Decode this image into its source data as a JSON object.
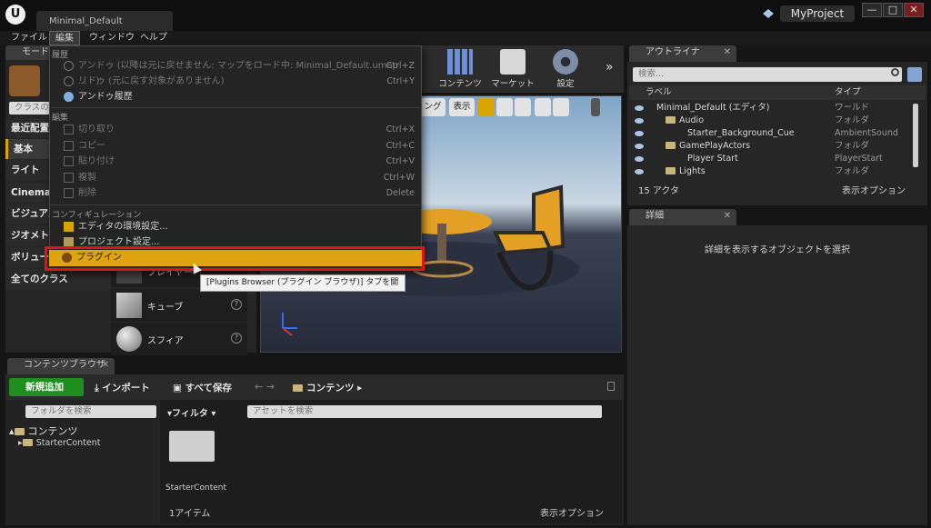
{
  "window": {
    "logo": "U",
    "doc_tab": "Minimal_Default",
    "project": "MyProject",
    "controls": [
      "—",
      "□",
      "✕"
    ]
  },
  "menubar": [
    "ファイル",
    "編集",
    "ウィンドウ",
    "ヘルプ"
  ],
  "modes": {
    "tab": "モード",
    "search_placeholder": "クラスの",
    "categories": [
      "最近配置",
      "基本",
      "ライト",
      "Cinemati",
      "ビジュアル",
      "ジオメト",
      "ボリュー",
      "全てのクラス"
    ],
    "assets": [
      "キューブ",
      "スフィア"
    ]
  },
  "edit_menu": {
    "history_section": "履歴",
    "undo": {
      "label": "アンドゥ (以降は元に戻せません: マップをロード中: Minimal_Default.umap ...　)",
      "shortcut": "Ctrl+Z"
    },
    "redo": {
      "label": "リドゥ (元に戻す対象がありません)",
      "shortcut": "Ctrl+Y"
    },
    "undo_history": "アンドゥ履歴",
    "edit_section": "編集",
    "cut": {
      "label": "切り取り",
      "shortcut": "Ctrl+X"
    },
    "copy": {
      "label": "コピー",
      "shortcut": "Ctrl+C"
    },
    "paste": {
      "label": "貼り付け",
      "shortcut": "Ctrl+V"
    },
    "duplicate": {
      "label": "複製",
      "shortcut": "Ctrl+W"
    },
    "delete": {
      "label": "削除",
      "shortcut": "Delete"
    },
    "config_section": "コンフィギュレーション",
    "editor_prefs": "エディタの環境設定...",
    "project_settings": "プロジェクト設定...",
    "plugins": "プラグイン",
    "tooltip": "[Plugins Browser (プラグイン ブラウザ)] タブを開きます。",
    "partial_asset": "プレイヤー"
  },
  "toolbar": {
    "content": "コンテンツ",
    "market": "マーケット",
    "settings": "設定"
  },
  "viewport": {
    "btn_lighting": "ング",
    "btn_show": "表示"
  },
  "outliner": {
    "tab": "アウトライナ",
    "search_placeholder": "検索...",
    "col_label": "ラベル",
    "col_type": "タイプ",
    "rows": [
      {
        "name": "Minimal_Default (エディタ)",
        "type": "ワールド"
      },
      {
        "name": "Audio",
        "type": "フォルダ"
      },
      {
        "name": "Starter_Background_Cue",
        "type": "AmbientSound"
      },
      {
        "name": "GamePlayActors",
        "type": "フォルダ"
      },
      {
        "name": "Player Start",
        "type": "PlayerStart"
      },
      {
        "name": "Lights",
        "type": "フォルダ"
      }
    ],
    "actor_count": "15 アクタ",
    "view_options": "表示オプション"
  },
  "details": {
    "tab": "詳細",
    "empty_message": "詳細を表示するオブジェクトを選択"
  },
  "content_browser": {
    "tab": "コンテンツブラウザ",
    "add_new": "新規追加",
    "import": "インポート",
    "save_all": "すべて保存",
    "path": "コンテンツ",
    "folder_search_placeholder": "フォルダを検索",
    "tree_root": "コンテンツ",
    "tree_child": "StarterContent",
    "filter": "フィルタ",
    "asset_search_placeholder": "アセットを検索",
    "folder_name": "StarterContent",
    "item_count": "1アイテム",
    "view_options": "表示オプション"
  },
  "colors": {
    "highlight_border": "#e0121a",
    "selection": "#e0a310",
    "add_button": "#1e8e1e"
  }
}
